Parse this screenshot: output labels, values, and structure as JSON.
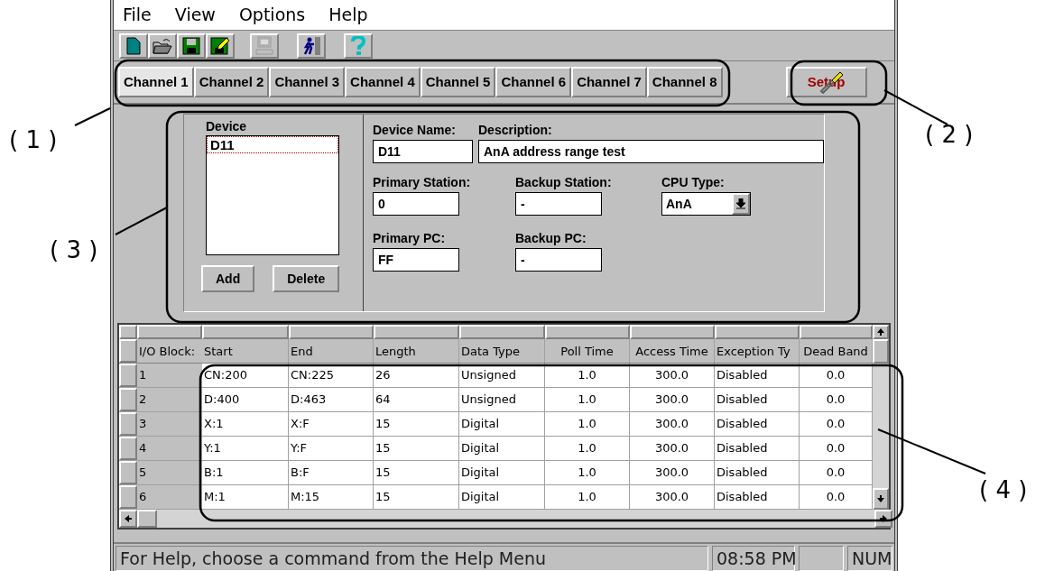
{
  "menu": [
    "File",
    "View",
    "Options",
    "Help"
  ],
  "toolbar": [
    {
      "kind": "new",
      "disabled": false
    },
    {
      "kind": "open",
      "disabled": false
    },
    {
      "kind": "save",
      "disabled": false
    },
    {
      "kind": "saveas",
      "disabled": false
    },
    {
      "kind": "computer",
      "disabled": true
    },
    {
      "kind": "run",
      "disabled": false
    },
    {
      "kind": "help",
      "disabled": false
    }
  ],
  "tabs": [
    {
      "label": "Channel 1",
      "selected": true
    },
    {
      "label": "Channel 2",
      "selected": false
    },
    {
      "label": "Channel 3",
      "selected": false
    },
    {
      "label": "Channel 4",
      "selected": false
    },
    {
      "label": "Channel 5",
      "selected": false
    },
    {
      "label": "Channel 6",
      "selected": false
    },
    {
      "label": "Channel 7",
      "selected": false
    },
    {
      "label": "Channel 8",
      "selected": false
    }
  ],
  "setup_button": "Setup",
  "device": {
    "title": "Device",
    "items": [
      {
        "label": "D11",
        "selected": true
      }
    ],
    "buttons": [
      "Add",
      "Delete"
    ]
  },
  "fields": {
    "device_name": {
      "label": "Device Name:",
      "value": "D11"
    },
    "description": {
      "label": "Description:",
      "value": "AnA address range test"
    },
    "primary_station": {
      "label": "Primary Station:",
      "value": "0"
    },
    "backup_station": {
      "label": "Backup Station:",
      "value": "-"
    },
    "cpu_type": {
      "label": "CPU Type:",
      "value": "AnA"
    },
    "primary_pc": {
      "label": "Primary PC:",
      "value": "FF"
    },
    "backup_pc": {
      "label": "Backup PC:",
      "value": "-"
    }
  },
  "table": {
    "row_header": "I/O Block:",
    "columns": [
      "Start",
      "End",
      "Length",
      "Data Type",
      "Poll Time",
      "Access Time",
      "Exception Ty",
      "Dead Band"
    ],
    "rows": [
      {
        "label": "1",
        "cells": [
          "CN:200",
          "CN:225",
          "26",
          "Unsigned",
          "1.0",
          "300.0",
          "Disabled",
          "0.0"
        ]
      },
      {
        "label": "2",
        "cells": [
          "D:400",
          "D:463",
          "64",
          "Unsigned",
          "1.0",
          "300.0",
          "Disabled",
          "0.0"
        ]
      },
      {
        "label": "3",
        "cells": [
          "X:1",
          "X:F",
          "15",
          "Digital",
          "1.0",
          "300.0",
          "Disabled",
          "0.0"
        ]
      },
      {
        "label": "4",
        "cells": [
          "Y:1",
          "Y:F",
          "15",
          "Digital",
          "1.0",
          "300.0",
          "Disabled",
          "0.0"
        ]
      },
      {
        "label": "5",
        "cells": [
          "B:1",
          "B:F",
          "15",
          "Digital",
          "1.0",
          "300.0",
          "Disabled",
          "0.0"
        ]
      },
      {
        "label": "6",
        "cells": [
          "M:1",
          "M:15",
          "15",
          "Digital",
          "1.0",
          "300.0",
          "Disabled",
          "0.0"
        ]
      }
    ]
  },
  "status_bar": {
    "message": "For Help, choose a command from the Help Menu",
    "time": "08:58 PM",
    "num": "NUM"
  },
  "callouts": [
    "( 1 )",
    "( 2 )",
    "( 3 )",
    "( 4 )"
  ]
}
